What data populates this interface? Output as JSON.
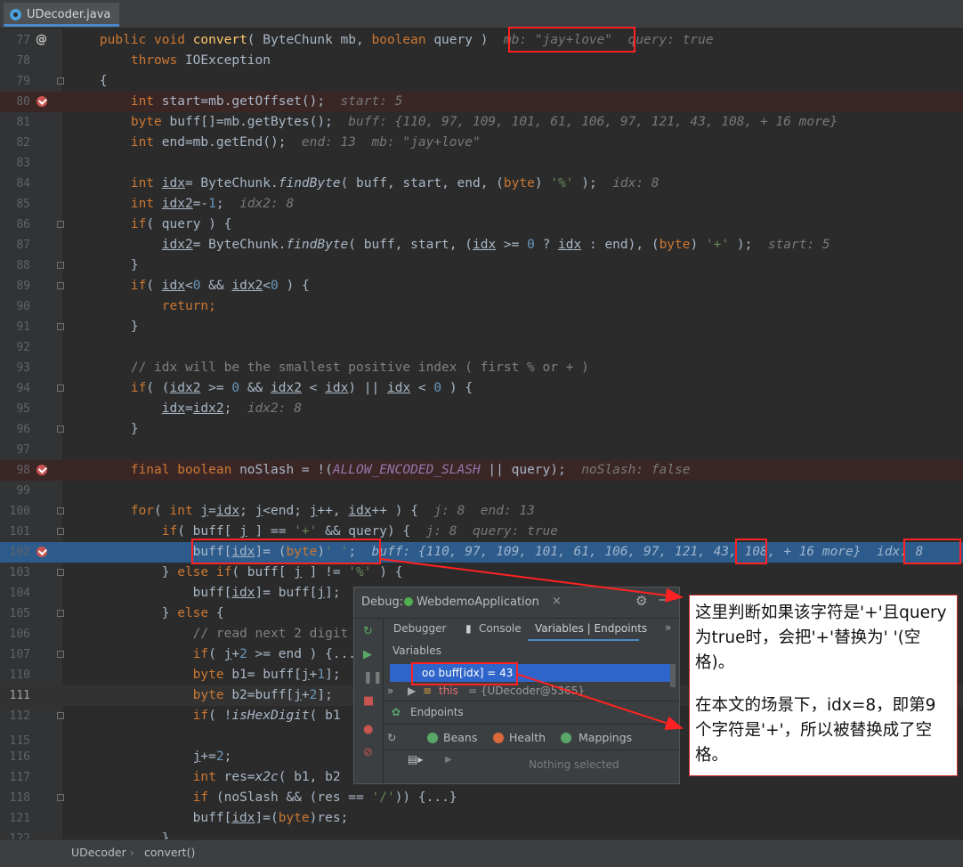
{
  "tab": {
    "filename": "UDecoder.java"
  },
  "code_lines": {
    "l77": {
      "num": "77",
      "mark": "@"
    },
    "l78": {
      "num": "78"
    },
    "l79": {
      "num": "79"
    },
    "l80": {
      "num": "80"
    },
    "l81": {
      "num": "81"
    },
    "l82": {
      "num": "82"
    },
    "l83": {
      "num": "83"
    },
    "l84": {
      "num": "84"
    },
    "l85": {
      "num": "85"
    },
    "l86": {
      "num": "86"
    },
    "l87": {
      "num": "87"
    },
    "l88": {
      "num": "88"
    },
    "l89": {
      "num": "89"
    },
    "l90": {
      "num": "90"
    },
    "l91": {
      "num": "91"
    },
    "l92": {
      "num": "92"
    },
    "l93": {
      "num": "93"
    },
    "l94": {
      "num": "94"
    },
    "l95": {
      "num": "95"
    },
    "l96": {
      "num": "96"
    },
    "l97": {
      "num": "97"
    },
    "l98": {
      "num": "98"
    },
    "l99": {
      "num": "99"
    },
    "l100": {
      "num": "100"
    },
    "l101": {
      "num": "101"
    },
    "l102": {
      "num": "102"
    },
    "l103": {
      "num": "103"
    },
    "l104": {
      "num": "104"
    },
    "l105": {
      "num": "105"
    },
    "l106": {
      "num": "106"
    },
    "l107": {
      "num": "107"
    },
    "l110": {
      "num": "110"
    },
    "l111": {
      "num": "111"
    },
    "l112": {
      "num": "112"
    },
    "l115": {
      "num": "115"
    },
    "l116": {
      "num": "116"
    },
    "l117": {
      "num": "117"
    },
    "l118": {
      "num": "118"
    },
    "l121": {
      "num": "121"
    },
    "l122": {
      "num": "122"
    }
  },
  "hints": {
    "l77_mb": "mb: \"jay+love\"",
    "l77_query": "query: true",
    "l80": "start: 5",
    "l81": "buff: {110, 97, 109, 101, 61, 106, 97, 121, 43, 108, + 16 more}",
    "l82": "end: 13  mb: \"jay+love\"",
    "l84": "idx: 8",
    "l85": "idx2: 8",
    "l86": "start: 5",
    "l95": "idx2: 8",
    "l98": "noSlash: false",
    "l100": "j: 8  end: 13",
    "l101": "j: 8  query: true",
    "l102_pre": "buff: {110, 97, 109, 101, 61, 106, 97, 121, ",
    "l102_val": "43",
    "l102_post": ", 108, + 16 more}",
    "l102_idx": "idx: 8"
  },
  "debug": {
    "title": "Debug:",
    "app": "WebdemoApplication",
    "close": "×",
    "tabs": {
      "debugger": "Debugger",
      "console": "Console",
      "variables": "Variables | Endpoints"
    },
    "more": "»",
    "variables_label": "Variables",
    "var1": "oo buff[idx] = 43",
    "var2_name": "this",
    "var2_value": "= {UDecoder@5365}",
    "endpoints": "Endpoints",
    "bottom_tabs": {
      "beans": "Beans",
      "health": "Health",
      "mappings": "Mappings"
    },
    "nothing_selected": "Nothing selected"
  },
  "annotation": {
    "para1": "这里判断如果该字符是'+'且query为true时，会把'+'替换为' '(空格)。",
    "para2": "在本文的场景下，idx=8，即第9个字符是'+'，所以被替换成了空格。"
  },
  "breadcrumb": {
    "class": "UDecoder",
    "sep": "›",
    "method": "convert()"
  },
  "colors": {
    "keyword": "#cc7832",
    "method": "#ffc66d",
    "number": "#6897bb",
    "string": "#6a8759",
    "comment": "#808080",
    "highlight": "#ff2222",
    "exec_line": "#2d5c8c"
  }
}
